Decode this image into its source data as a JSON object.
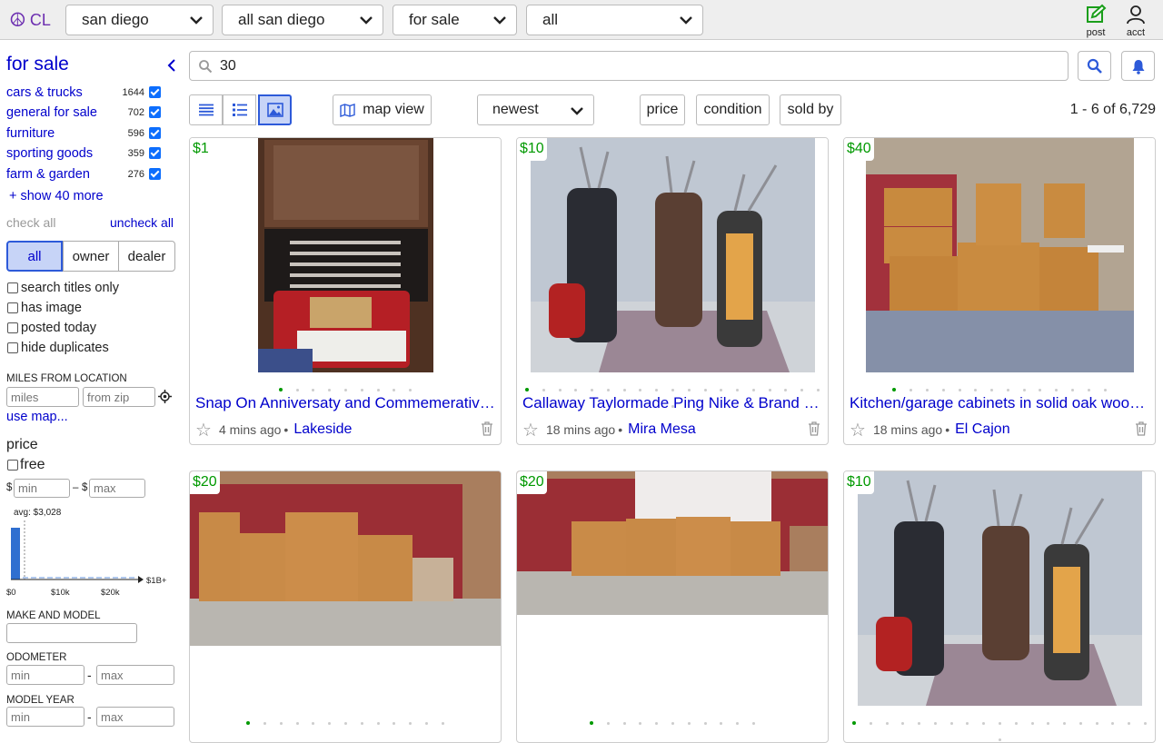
{
  "topbar": {
    "logo_text": "CL",
    "area": "san diego",
    "subarea": "all san diego",
    "category": "for sale",
    "type": "all",
    "post_label": "post",
    "acct_label": "acct"
  },
  "sidebar": {
    "title": "for sale",
    "categories": [
      {
        "label": "cars & trucks",
        "count": "1644"
      },
      {
        "label": "general for sale",
        "count": "702"
      },
      {
        "label": "furniture",
        "count": "596"
      },
      {
        "label": "sporting goods",
        "count": "359"
      },
      {
        "label": "farm & garden",
        "count": "276"
      }
    ],
    "show_more": "+ show 40 more",
    "check_all": "check all",
    "uncheck_all": "uncheck all",
    "seller": {
      "all": "all",
      "owner": "owner",
      "dealer": "dealer"
    },
    "options": [
      "search titles only",
      "has image",
      "posted today",
      "hide duplicates"
    ],
    "miles_label": "MILES FROM LOCATION",
    "miles_placeholder": "miles",
    "zip_placeholder": "from zip",
    "use_map": "use map...",
    "price_label": "price",
    "free_label": "free",
    "dollar": "$",
    "dash": "–",
    "min_placeholder": "min",
    "max_placeholder": "max",
    "avg_label": "avg: $3,028",
    "hist_ticks": [
      "$0",
      "$10k",
      "$20k",
      "$1B+"
    ],
    "make_label": "MAKE AND MODEL",
    "odometer_label": "ODOMETER",
    "model_year_label": "MODEL YEAR",
    "range_dash": "-"
  },
  "main": {
    "query": "30",
    "map_view": "map view",
    "sort": "newest",
    "filters": [
      "price",
      "condition",
      "sold by"
    ],
    "result_count": "1 - 6 of 6,729",
    "listings": [
      {
        "price": "$1",
        "title": "Snap On Anniversaty and Commemerative Wrench Set",
        "time": "4 mins ago",
        "location": "Lakeside"
      },
      {
        "price": "$10",
        "title": "Callaway Taylormade Ping Nike & Brand Name Golf Clubs",
        "time": "18 mins ago",
        "location": "Mira Mesa"
      },
      {
        "price": "$40",
        "title": "Kitchen/garage cabinets in solid oak wood or sale",
        "time": "18 mins ago",
        "location": "El Cajon"
      },
      {
        "price": "$20"
      },
      {
        "price": "$20"
      },
      {
        "price": "$10"
      }
    ]
  },
  "colors": {
    "link": "#0000cc",
    "price": "#009900",
    "accent": "#2d5ad9",
    "brand": "#6c2eb0",
    "post_icon": "#1a9e1a"
  }
}
